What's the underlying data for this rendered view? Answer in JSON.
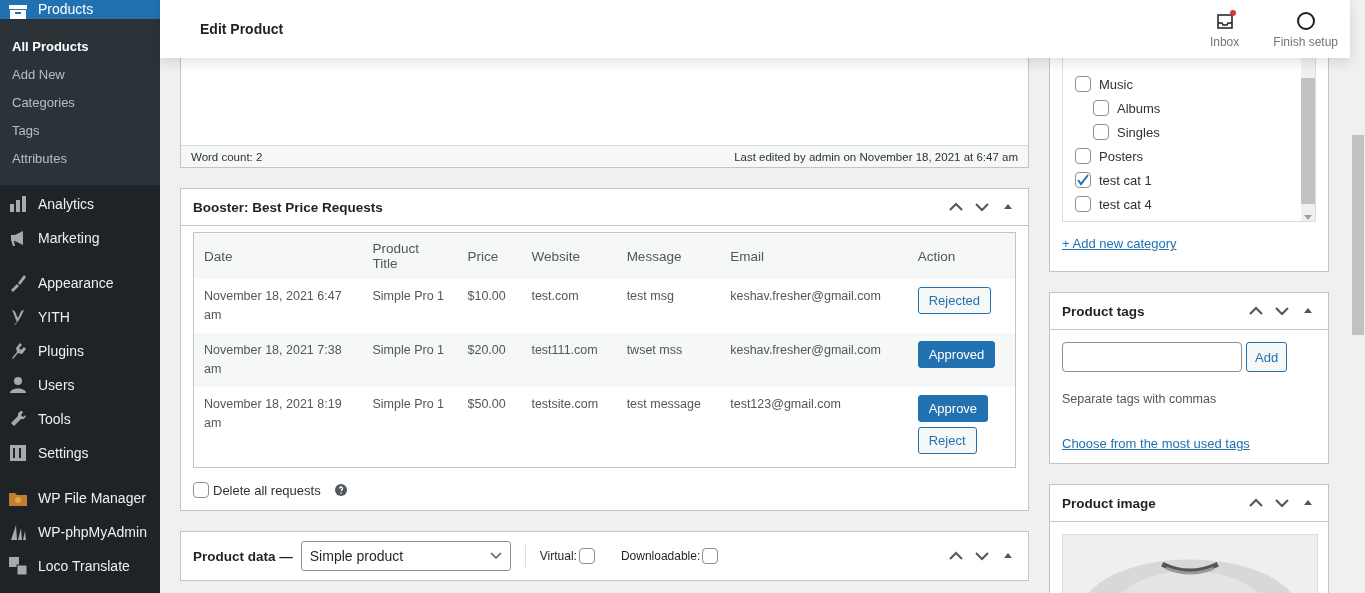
{
  "sidebar": {
    "current": {
      "label": "Products",
      "selected": true
    },
    "submenu": [
      {
        "label": "All Products",
        "selected": true
      },
      {
        "label": "Add New",
        "selected": false
      },
      {
        "label": "Categories",
        "selected": false
      },
      {
        "label": "Tags",
        "selected": false
      },
      {
        "label": "Attributes",
        "selected": false
      }
    ],
    "menu_groups": [
      [
        {
          "label": "Analytics"
        },
        {
          "label": "Marketing"
        }
      ],
      [
        {
          "label": "Appearance"
        },
        {
          "label": "YITH"
        },
        {
          "label": "Plugins"
        },
        {
          "label": "Users"
        },
        {
          "label": "Tools"
        },
        {
          "label": "Settings"
        }
      ],
      [
        {
          "label": "WP File Manager"
        },
        {
          "label": "WP-phpMyAdmin"
        },
        {
          "label": "Loco Translate"
        }
      ]
    ]
  },
  "header": {
    "title": "Edit Product",
    "actions": [
      {
        "label": "Inbox",
        "unread": true
      },
      {
        "label": "Finish setup",
        "unread": false
      }
    ]
  },
  "editor": {
    "word_count": "Word count: 2",
    "last_edited": "Last edited by admin on November 18, 2021 at 6:47 am"
  },
  "best_price_requests": {
    "title": "Booster: Best Price Requests",
    "columns": [
      "Date",
      "Product Title",
      "Price",
      "Website",
      "Message",
      "Email",
      "Action"
    ],
    "rows": [
      {
        "cells": [
          "November 18, 2021 6:47 am",
          "Simple Pro 1",
          "$10.00",
          "test.com",
          "test msg",
          "keshav.fresher@gmail.com"
        ],
        "actions": [
          {
            "label": "Rejected",
            "primary": false
          }
        ]
      },
      {
        "cells": [
          "November 18, 2021 7:38 am",
          "Simple Pro 1",
          "$20.00",
          "test111.com",
          "twset mss",
          "keshav.fresher@gmail.com"
        ],
        "actions": [
          {
            "label": "Approved",
            "primary": true
          }
        ]
      },
      {
        "cells": [
          "November 18, 2021 8:19 am",
          "Simple Pro 1",
          "$50.00",
          "testsite.com",
          "test message",
          "test123@gmail.com"
        ],
        "actions": [
          {
            "label": "Approve",
            "primary": true
          },
          {
            "label": "Reject",
            "primary": false
          }
        ]
      }
    ],
    "delete_all": {
      "label": "Delete all requests",
      "checked": false
    }
  },
  "product_data": {
    "title": "Product data —",
    "type": "Simple product",
    "options": [
      {
        "label": "Virtual:",
        "checked": false
      },
      {
        "label": "Downloadable:",
        "checked": false
      }
    ]
  },
  "categories": {
    "items": [
      {
        "label": "Music",
        "checked": false,
        "children": [
          {
            "label": "Albums",
            "checked": false
          },
          {
            "label": "Singles",
            "checked": false
          }
        ]
      },
      {
        "label": "Posters",
        "checked": false
      },
      {
        "label": "test cat 1",
        "checked": true
      },
      {
        "label": "test cat 4",
        "checked": false
      }
    ],
    "add_link": "+ Add new category"
  },
  "tags": {
    "title": "Product tags",
    "button": "Add",
    "hint": "Separate tags with commas",
    "link": "Choose from the most used tags"
  },
  "image": {
    "title": "Product image",
    "kind": "picture"
  }
}
